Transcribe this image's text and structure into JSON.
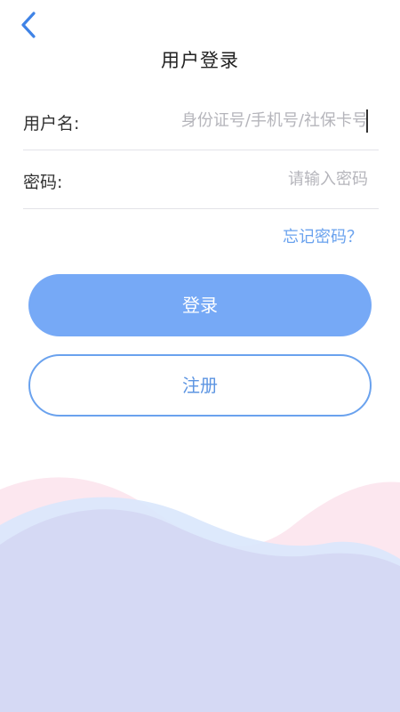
{
  "header": {
    "back_icon": "chevron-left-icon",
    "title": "用户登录"
  },
  "form": {
    "username": {
      "label": "用户名:",
      "placeholder": "身份证号/手机号/社保卡号",
      "value": ""
    },
    "password": {
      "label": "密码:",
      "placeholder": "请输入密码",
      "value": ""
    },
    "forgot_label": "忘记密码？"
  },
  "actions": {
    "login_label": "登录",
    "register_label": "注册"
  },
  "colors": {
    "accent": "#76a9f6",
    "link": "#6aa2ee",
    "wave_pink": "#fbe3ec",
    "wave_lavender": "#d5d9f4",
    "wave_blue": "#d9e7fc"
  }
}
